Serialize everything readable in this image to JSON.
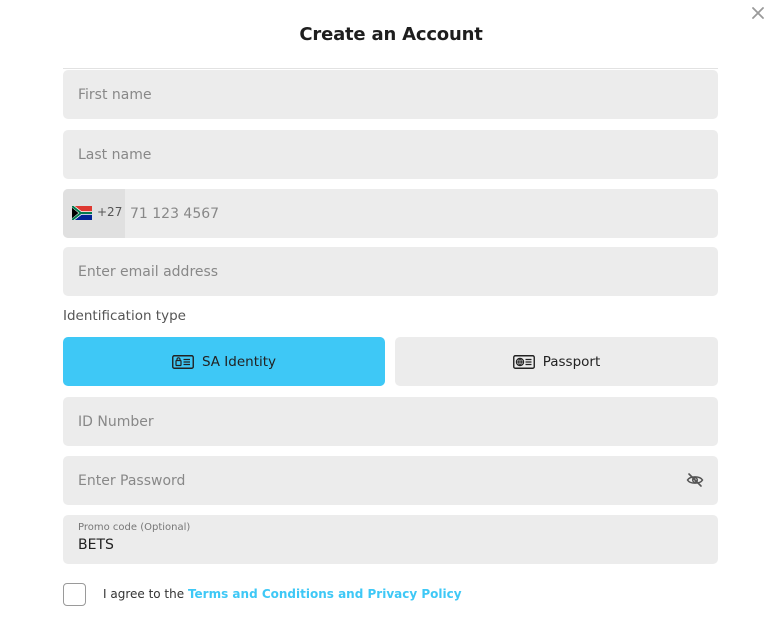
{
  "dialog": {
    "title": "Create an Account"
  },
  "form": {
    "first_name": {
      "placeholder": "First name",
      "value": ""
    },
    "last_name": {
      "placeholder": "Last name",
      "value": ""
    },
    "phone": {
      "dial_code": "+27",
      "placeholder": "71 123 4567",
      "value": "",
      "flag": "south-africa-flag-icon"
    },
    "email": {
      "placeholder": "Enter email address",
      "value": ""
    },
    "identification": {
      "label": "Identification type",
      "options": [
        {
          "label": "SA Identity",
          "icon": "id-card-icon",
          "selected": true
        },
        {
          "label": "Passport",
          "icon": "passport-icon",
          "selected": false
        }
      ]
    },
    "id_number": {
      "placeholder": "ID Number",
      "value": ""
    },
    "password": {
      "placeholder": "Enter Password",
      "value": "",
      "toggle_icon": "eye-slash-icon"
    },
    "promo": {
      "label": "Promo code (Optional)",
      "value": "BETS"
    },
    "agree": {
      "checked": false,
      "text": "I agree to the ",
      "link": "Terms and Conditions and Privacy Policy"
    }
  },
  "colors": {
    "accent": "#3ec8f6",
    "field_bg": "#ececec",
    "country_bg": "#e0e0e0"
  }
}
